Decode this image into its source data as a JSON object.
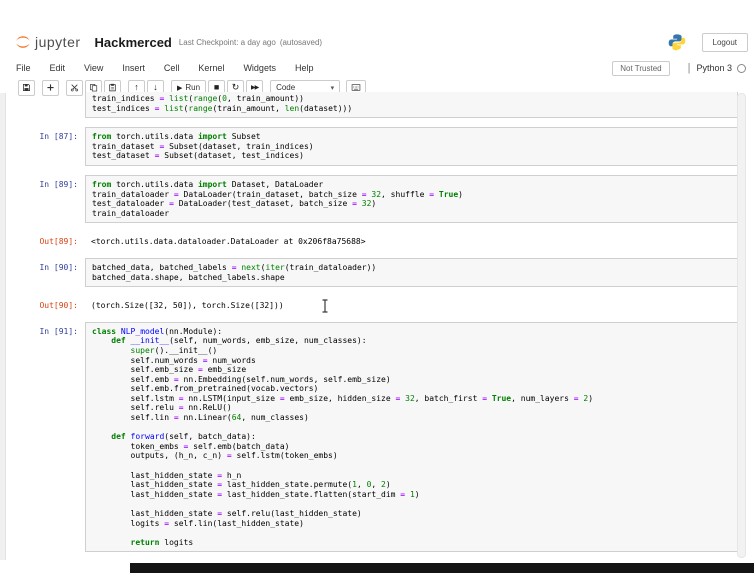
{
  "header": {
    "logo_text": "jupyter",
    "title": "Hackmerced",
    "checkpoint": "Last Checkpoint: a day ago",
    "autosaved": "(autosaved)",
    "logout_label": "Logout"
  },
  "menubar": {
    "items": [
      "File",
      "Edit",
      "View",
      "Insert",
      "Cell",
      "Kernel",
      "Widgets",
      "Help"
    ],
    "trust_badge": "Not Trusted",
    "kernel_name": "Python 3"
  },
  "toolbar": {
    "run_label": "Run",
    "run_play_glyph": "▶",
    "stop_glyph": "■",
    "restart_glyph": "↻",
    "ff_glyph": "▶▶",
    "up_glyph": "↑",
    "down_glyph": "↓",
    "cell_type": "Code",
    "chevron_glyph": "▾"
  },
  "colors": {
    "jupyter_orange": "#f37726",
    "python_blue": "#3776ab",
    "python_yellow": "#ffd43b",
    "in_prompt": "#303f9f",
    "out_prompt": "#d84315",
    "keyword_green": "#008000",
    "operator_purple": "#aa22ff",
    "def_blue": "#0000ff"
  },
  "notebook": {
    "cells": [
      {
        "type": "code",
        "prompt": "",
        "clipped": true,
        "lines": [
          [
            [
              "train_indices ",
              "v"
            ],
            [
              "=",
              "o"
            ],
            [
              " ",
              "v"
            ],
            [
              "list",
              "b"
            ],
            [
              "(",
              "v"
            ],
            [
              "range",
              "b"
            ],
            [
              "(",
              "v"
            ],
            [
              "0",
              "n"
            ],
            [
              ", train_amount))",
              "v"
            ]
          ],
          [
            [
              "test_indices ",
              "v"
            ],
            [
              "=",
              "o"
            ],
            [
              " ",
              "v"
            ],
            [
              "list",
              "b"
            ],
            [
              "(",
              "v"
            ],
            [
              "range",
              "b"
            ],
            [
              "(train_amount, ",
              "v"
            ],
            [
              "len",
              "b"
            ],
            [
              "(dataset)))",
              "v"
            ]
          ]
        ]
      },
      {
        "type": "code",
        "prompt": "In [87]:",
        "lines": [
          [
            [
              "from",
              "k"
            ],
            [
              " torch.utils.data ",
              "v"
            ],
            [
              "import",
              "k"
            ],
            [
              " Subset",
              "v"
            ]
          ],
          [
            [
              "train_dataset ",
              "v"
            ],
            [
              "=",
              "o"
            ],
            [
              " Subset(dataset, train_indices)",
              "v"
            ]
          ],
          [
            [
              "test_dataset ",
              "v"
            ],
            [
              "=",
              "o"
            ],
            [
              " Subset(dataset, test_indices)",
              "v"
            ]
          ]
        ]
      },
      {
        "type": "code",
        "prompt": "In [89]:",
        "lines": [
          [
            [
              "from",
              "k"
            ],
            [
              " torch.utils.data ",
              "v"
            ],
            [
              "import",
              "k"
            ],
            [
              " Dataset, DataLoader",
              "v"
            ]
          ],
          [
            [
              "train_dataloader ",
              "v"
            ],
            [
              "=",
              "o"
            ],
            [
              " DataLoader(train_dataset, batch_size ",
              "v"
            ],
            [
              "=",
              "o"
            ],
            [
              " ",
              "v"
            ],
            [
              "32",
              "n"
            ],
            [
              ", shuffle ",
              "v"
            ],
            [
              "=",
              "o"
            ],
            [
              " ",
              "v"
            ],
            [
              "True",
              "k"
            ],
            [
              ")",
              "v"
            ]
          ],
          [
            [
              "test_dataloader ",
              "v"
            ],
            [
              "=",
              "o"
            ],
            [
              " DataLoader(test_dataset, batch_size ",
              "v"
            ],
            [
              "=",
              "o"
            ],
            [
              " ",
              "v"
            ],
            [
              "32",
              "n"
            ],
            [
              ")",
              "v"
            ]
          ],
          [
            [
              "train_dataloader",
              "v"
            ]
          ]
        ]
      },
      {
        "type": "output",
        "prompt": "Out[89]:",
        "text": "<torch.utils.data.dataloader.DataLoader at 0x206f8a75688>"
      },
      {
        "type": "code",
        "prompt": "In [90]:",
        "lines": [
          [
            [
              "batched_data, batched_labels ",
              "v"
            ],
            [
              "=",
              "o"
            ],
            [
              " ",
              "v"
            ],
            [
              "next",
              "b"
            ],
            [
              "(",
              "v"
            ],
            [
              "iter",
              "b"
            ],
            [
              "(train_dataloader))",
              "v"
            ]
          ],
          [
            [
              "batched_data.shape, batched_labels.shape",
              "v"
            ]
          ]
        ]
      },
      {
        "type": "output",
        "prompt": "Out[90]:",
        "text": "(torch.Size([32, 50]), torch.Size([32]))"
      },
      {
        "type": "code",
        "prompt": "In [91]:",
        "lines": [
          [
            [
              "class",
              "k"
            ],
            [
              " ",
              "v"
            ],
            [
              "NLP_model",
              "d"
            ],
            [
              "(nn.Module):",
              "v"
            ]
          ],
          [
            [
              "    ",
              "v"
            ],
            [
              "def",
              "k"
            ],
            [
              " ",
              "v"
            ],
            [
              "__init__",
              "d"
            ],
            [
              "(self, num_words, emb_size, num_classes):",
              "v"
            ]
          ],
          [
            [
              "        ",
              "v"
            ],
            [
              "super",
              "b"
            ],
            [
              "().__init__()",
              "v"
            ]
          ],
          [
            [
              "        self.num_words ",
              "v"
            ],
            [
              "=",
              "o"
            ],
            [
              " num_words",
              "v"
            ]
          ],
          [
            [
              "        self.emb_size ",
              "v"
            ],
            [
              "=",
              "o"
            ],
            [
              " emb_size",
              "v"
            ]
          ],
          [
            [
              "        self.emb ",
              "v"
            ],
            [
              "=",
              "o"
            ],
            [
              " nn.Embedding(self.num_words, self.emb_size)",
              "v"
            ]
          ],
          [
            [
              "        self.emb.from_pretrained(vocab.vectors)",
              "v"
            ]
          ],
          [
            [
              "        self.lstm ",
              "v"
            ],
            [
              "=",
              "o"
            ],
            [
              " nn.LSTM(input_size ",
              "v"
            ],
            [
              "=",
              "o"
            ],
            [
              " emb_size, hidden_size ",
              "v"
            ],
            [
              "=",
              "o"
            ],
            [
              " ",
              "v"
            ],
            [
              "32",
              "n"
            ],
            [
              ", batch_first ",
              "v"
            ],
            [
              "=",
              "o"
            ],
            [
              " ",
              "v"
            ],
            [
              "True",
              "k"
            ],
            [
              ", num_layers ",
              "v"
            ],
            [
              "=",
              "o"
            ],
            [
              " ",
              "v"
            ],
            [
              "2",
              "n"
            ],
            [
              ")",
              "v"
            ]
          ],
          [
            [
              "        self.relu ",
              "v"
            ],
            [
              "=",
              "o"
            ],
            [
              " nn.ReLU()",
              "v"
            ]
          ],
          [
            [
              "        self.lin ",
              "v"
            ],
            [
              "=",
              "o"
            ],
            [
              " nn.Linear(",
              "v"
            ],
            [
              "64",
              "n"
            ],
            [
              ", num_classes)",
              "v"
            ]
          ],
          [],
          [
            [
              "    ",
              "v"
            ],
            [
              "def",
              "k"
            ],
            [
              " ",
              "v"
            ],
            [
              "forward",
              "d"
            ],
            [
              "(self, batch_data):",
              "v"
            ]
          ],
          [
            [
              "        token_embs ",
              "v"
            ],
            [
              "=",
              "o"
            ],
            [
              " self.emb(batch_data)",
              "v"
            ]
          ],
          [
            [
              "        outputs, (h_n, c_n) ",
              "v"
            ],
            [
              "=",
              "o"
            ],
            [
              " self.lstm(token_embs)",
              "v"
            ]
          ],
          [],
          [
            [
              "        last_hidden_state ",
              "v"
            ],
            [
              "=",
              "o"
            ],
            [
              " h_n",
              "v"
            ]
          ],
          [
            [
              "        last_hidden_state ",
              "v"
            ],
            [
              "=",
              "o"
            ],
            [
              " last_hidden_state.permute(",
              "v"
            ],
            [
              "1",
              "n"
            ],
            [
              ", ",
              "v"
            ],
            [
              "0",
              "n"
            ],
            [
              ", ",
              "v"
            ],
            [
              "2",
              "n"
            ],
            [
              ")",
              "v"
            ]
          ],
          [
            [
              "        last_hidden_state ",
              "v"
            ],
            [
              "=",
              "o"
            ],
            [
              " last_hidden_state.flatten(start_dim ",
              "v"
            ],
            [
              "=",
              "o"
            ],
            [
              " ",
              "v"
            ],
            [
              "1",
              "n"
            ],
            [
              ")",
              "v"
            ]
          ],
          [],
          [
            [
              "        last_hidden_state ",
              "v"
            ],
            [
              "=",
              "o"
            ],
            [
              " self.relu(last_hidden_state)",
              "v"
            ]
          ],
          [
            [
              "        logits ",
              "v"
            ],
            [
              "=",
              "o"
            ],
            [
              " self.lin(last_hidden_state)",
              "v"
            ]
          ],
          [],
          [
            [
              "        ",
              "v"
            ],
            [
              "return",
              "k"
            ],
            [
              " logits",
              "v"
            ]
          ]
        ]
      }
    ]
  }
}
